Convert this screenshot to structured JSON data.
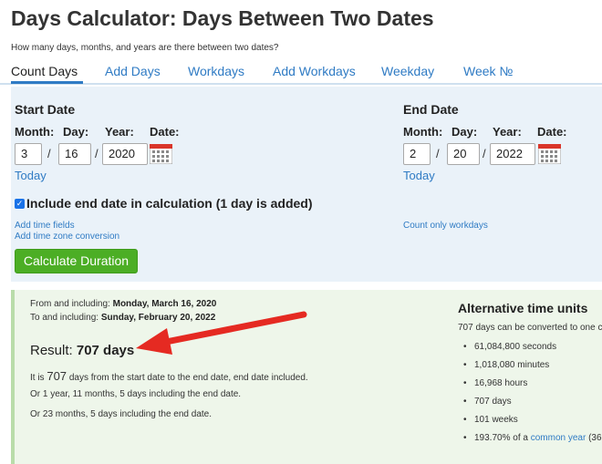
{
  "page": {
    "title": "Days Calculator: Days Between Two Dates",
    "subtitle": "How many days, months, and years are there between two dates?"
  },
  "tabs": [
    {
      "label": "Count Days",
      "active": true
    },
    {
      "label": "Add Days"
    },
    {
      "label": "Workdays"
    },
    {
      "label": "Add Workdays"
    },
    {
      "label": "Weekday"
    },
    {
      "label": "Week №"
    }
  ],
  "start": {
    "title": "Start Date",
    "labels": {
      "month": "Month:",
      "day": "Day:",
      "year": "Year:",
      "date": "Date:"
    },
    "month": "3",
    "day": "16",
    "year": "2020",
    "today_link": "Today"
  },
  "end": {
    "title": "End Date",
    "labels": {
      "month": "Month:",
      "day": "Day:",
      "year": "Year:",
      "date": "Date:"
    },
    "month": "2",
    "day": "20",
    "year": "2022",
    "today_link": "Today"
  },
  "separators": {
    "slash": "/"
  },
  "options": {
    "include_end_label": "Include end date in calculation (1 day is added)",
    "include_end_checked": true,
    "add_time_fields": "Add time fields",
    "add_timezone": "Add time zone conversion",
    "count_workdays": "Count only workdays"
  },
  "button": {
    "calculate": "Calculate Duration"
  },
  "result": {
    "from_prefix": "From and including: ",
    "from_date": "Monday, March 16, 2020",
    "to_prefix": "To and including: ",
    "to_date": "Sunday, February 20, 2022",
    "result_prefix": "Result: ",
    "result_value": "707 days",
    "line1_prefix": "It is ",
    "line1_num": "707",
    "line1_suffix": " days from the start date to the end date, end date included.",
    "line2": "Or 1 year, 11 months, 5 days including the end date.",
    "line3": "Or 23 months, 5 days including the end date."
  },
  "alternative": {
    "title": "Alternative time units",
    "intro": "707 days can be converted to one c",
    "items": [
      "61,084,800 seconds",
      "1,018,080 minutes",
      "16,968 hours",
      "707 days",
      "101 weeks"
    ],
    "last_prefix": "193.70% of a ",
    "last_link": "common year",
    "last_suffix": " (36"
  },
  "colors": {
    "accent": "#2f7bc4",
    "button": "#4cae25",
    "arrow": "#e52a22",
    "calendar": "#d9352a"
  }
}
